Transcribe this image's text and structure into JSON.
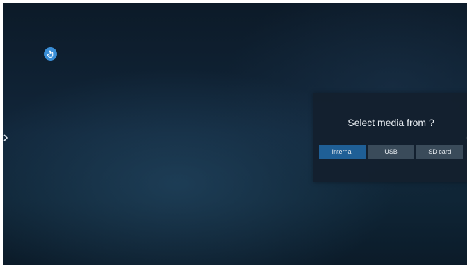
{
  "dialog": {
    "title": "Select media from ?",
    "options": [
      {
        "label": "Internal",
        "selected": true
      },
      {
        "label": "USB",
        "selected": false
      },
      {
        "label": "SD card",
        "selected": false
      }
    ]
  },
  "icons": {
    "floating_button": "hand-pointer-icon",
    "left_edge": "chevron-right-icon",
    "right_edge": "chevron-left-icon"
  },
  "colors": {
    "accent": "#3a8ed6",
    "selected_option": "#1f5f96",
    "option": "#3a4b5a",
    "text": "#e6ebf0",
    "background": "#11263a"
  }
}
